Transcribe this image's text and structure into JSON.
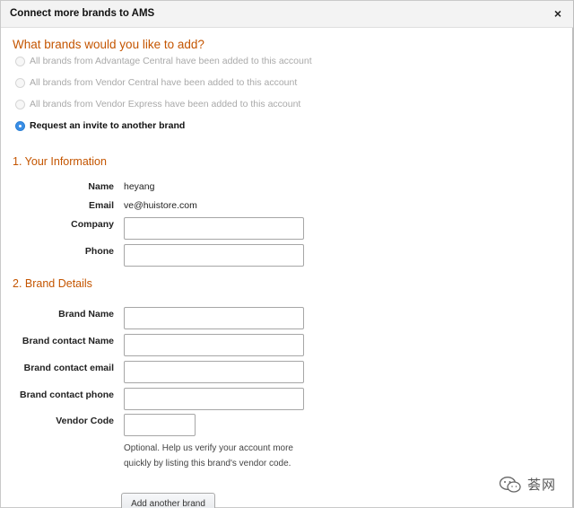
{
  "dialog": {
    "title": "Connect more brands to AMS",
    "close_label": "×"
  },
  "question": "What brands would you like to add?",
  "options": [
    {
      "label": "All brands from Advantage Central have been added to this account",
      "checked": false,
      "disabled": true
    },
    {
      "label": "All brands from Vendor Central have been added to this account",
      "checked": false,
      "disabled": true
    },
    {
      "label": "All brands from Vendor Express have been added to this account",
      "checked": false,
      "disabled": true
    },
    {
      "label": "Request an invite to another brand",
      "checked": true,
      "disabled": false
    }
  ],
  "your_info": {
    "heading": "1. Your Information",
    "name_label": "Name",
    "name_value": "heyang",
    "email_label": "Email",
    "email_value": "ve@huistore.com",
    "company_label": "Company",
    "company_value": "",
    "phone_label": "Phone",
    "phone_value": ""
  },
  "brand_details": {
    "heading": "2. Brand Details",
    "brand_name_label": "Brand Name",
    "brand_contact_name_label": "Brand contact Name",
    "brand_contact_email_label": "Brand contact email",
    "brand_contact_phone_label": "Brand contact phone",
    "vendor_code_label": "Vendor Code",
    "brand_name_value": "",
    "brand_contact_name_value": "",
    "brand_contact_email_value": "",
    "brand_contact_phone_value": "",
    "vendor_code_value": "",
    "vendor_code_help": "Optional. Help us verify your account more quickly by listing this brand's vendor code.",
    "add_another_label": "Add another brand"
  },
  "watermark": {
    "text": "荟网",
    "icon": "wechat-icon"
  },
  "colors": {
    "accent_orange": "#c45500",
    "radio_selected": "#3a8ee6",
    "header_bg": "#f3f3f3"
  }
}
